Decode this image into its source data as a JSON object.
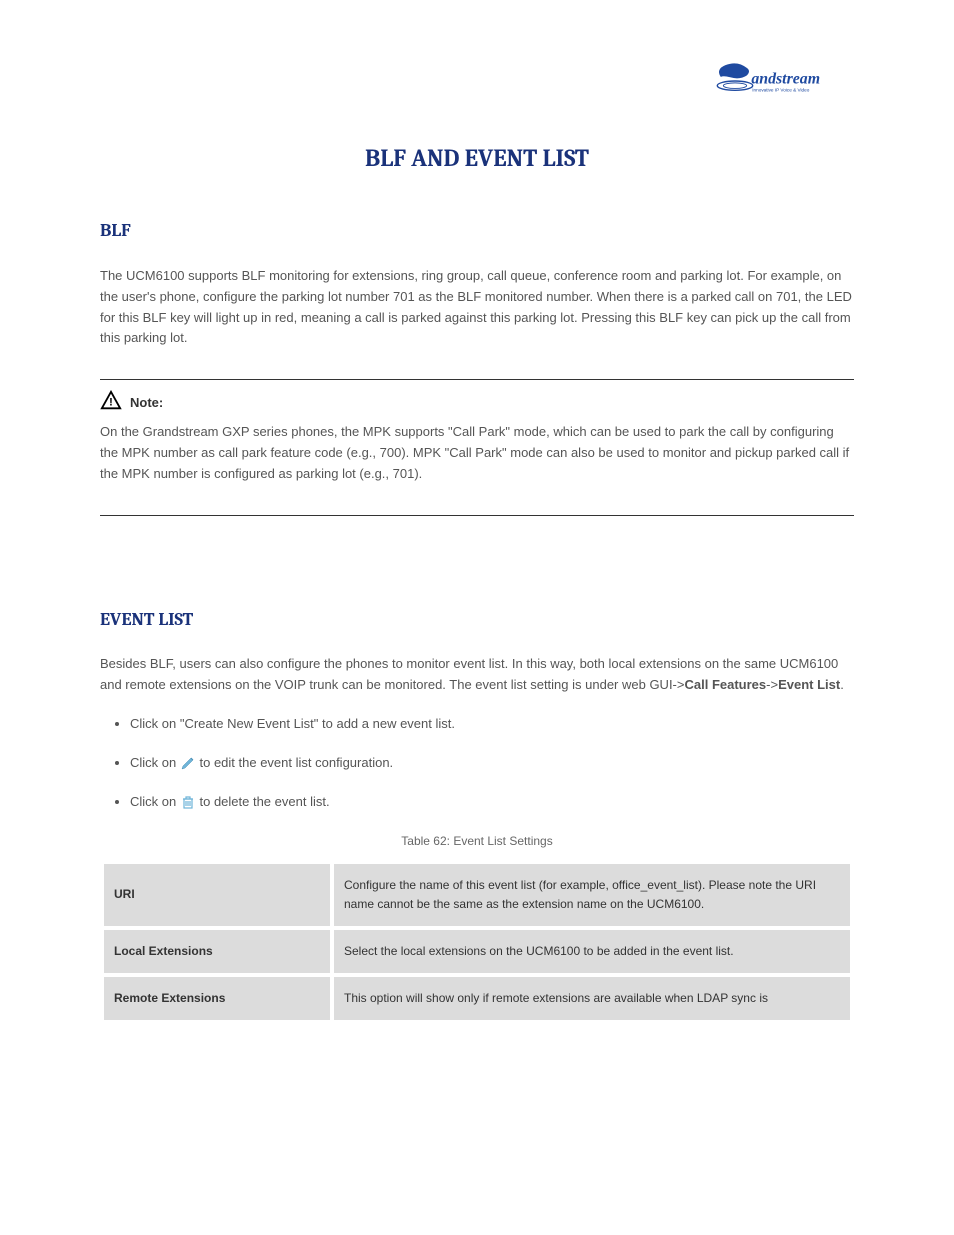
{
  "logo": {
    "brand": "Grandstream",
    "tagline": "Innovative IP Voice & Video"
  },
  "title": "BLF AND EVENT LIST",
  "blf": {
    "heading": "BLF",
    "p1": "The UCM6100 supports BLF monitoring for extensions, ring group, call queue, conference room and parking lot. For example, on the user's phone, configure the parking lot number 701 as the BLF monitored number. When there is a parked call on 701, the LED for this BLF key will light up in red, meaning a call is parked against this parking lot. Pressing this BLF key can pick up the call from this parking lot.",
    "noteLabel": "Note:",
    "noteBody": "On the Grandstream GXP series phones, the MPK supports \"Call Park\" mode, which can be used to park the call by configuring the MPK number as call park feature code (e.g., 700). MPK \"Call Park\" mode can also be used to monitor and pickup parked call if the MPK number is configured as parking lot (e.g., 701)."
  },
  "eventList": {
    "heading": "EVENT LIST",
    "p1_part1": "Besides BLF, users can also configure the phones to monitor event list. In this way, both local extensions on the same UCM6100 and remote extensions on the VOIP trunk can be monitored. The event list setting is under web GUI->",
    "p1_part2": "Call Features",
    "p1_part3": "->",
    "p1_part4": "Event List",
    "p1_part5": ".",
    "liNew": "Click on \"Create New Event List\" to add a new event list.",
    "liEdit_pre": "Click on ",
    "liEdit_post": " to edit the event list configuration.",
    "liDelete_pre": "Click on ",
    "liDelete_post": " to delete the event list.",
    "tableCaption": "Table 62: Event List Settings",
    "rows": [
      {
        "label": "URI",
        "desc": "Configure the name of this event list (for example, office_event_list). Please note the URI name cannot be the same as the extension name on the UCM6100."
      },
      {
        "label": "Local Extensions",
        "desc": "Select the local extensions on the UCM6100 to be added in the event list."
      },
      {
        "label": "Remote Extensions",
        "desc": "This option will show only if remote extensions are available when LDAP sync is"
      }
    ]
  }
}
